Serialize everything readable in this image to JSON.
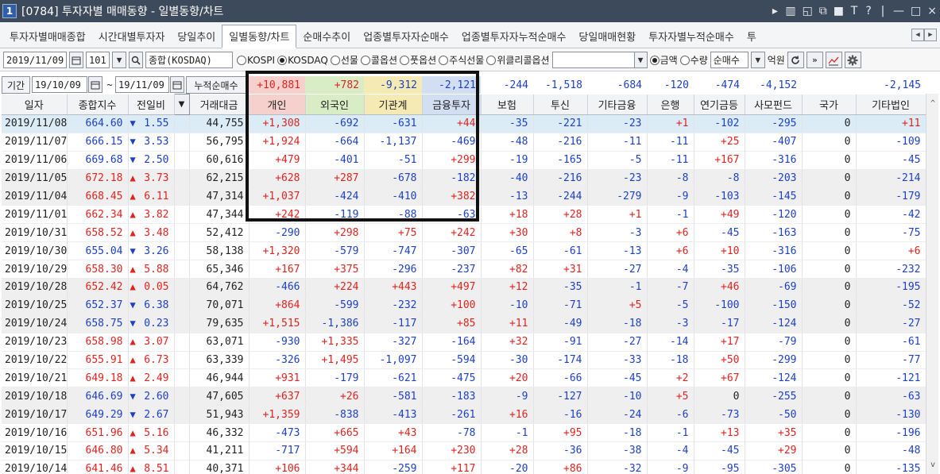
{
  "window": {
    "number": "1",
    "title": "[0784] 투자자별 매매동향 - 일별동향/차트",
    "controls": [
      "▸",
      "▥",
      "◱",
      "⧉",
      "■",
      "T",
      "?",
      "|",
      "—",
      "□",
      "×"
    ]
  },
  "tabs": [
    {
      "label": "투자자별매매종합",
      "active": false
    },
    {
      "label": "시간대별투자자",
      "active": false
    },
    {
      "label": "당일추이",
      "active": false
    },
    {
      "label": "일별동향/차트",
      "active": true
    },
    {
      "label": "순매수추이",
      "active": false
    },
    {
      "label": "업종별투자자순매수",
      "active": false
    },
    {
      "label": "업종별투자자누적순매수",
      "active": false
    },
    {
      "label": "당일매매현황",
      "active": false
    },
    {
      "label": "투자자별누적순매수",
      "active": false
    },
    {
      "label": "투",
      "active": false
    }
  ],
  "tab_nav": {
    "prev": "◀",
    "next": "▶"
  },
  "toolbar": {
    "date": "2019/11/09",
    "calendar_icon": "calendar-icon",
    "code": "101",
    "code_dropdown": "▼",
    "search_icon": "search-icon",
    "index_name": "종합(KOSDAQ)",
    "market_radios": [
      {
        "label": "KOSPI",
        "checked": false
      },
      {
        "label": "KOSDAQ",
        "checked": true
      },
      {
        "label": "선물",
        "checked": false
      },
      {
        "label": "콜옵션",
        "checked": false
      },
      {
        "label": "풋옵션",
        "checked": false
      },
      {
        "label": "주식선물",
        "checked": false
      },
      {
        "label": "위클리콜옵션",
        "checked": false
      }
    ],
    "amount_radios": [
      {
        "label": "금액",
        "checked": true
      },
      {
        "label": "수량",
        "checked": false
      }
    ],
    "sort_select": "순매수",
    "sort_dropdown": "▼",
    "unit": "억원",
    "refresh_icon": "refresh-icon",
    "next_icon": "double-chevron-right-icon",
    "chart_icon": "chart-icon",
    "settings_icon": "gear-icon"
  },
  "summary": {
    "period_label": "기간",
    "start_date": "19/10/09",
    "tilde": "~",
    "end_date": "19/11/09",
    "cumulative_label": "누적순매수",
    "totals": [
      "+10,881",
      "+782",
      "-9,312",
      "-2,121",
      "-244",
      "-1,518",
      "-684",
      "-120",
      "-474",
      "-4,152",
      "",
      "-2,145"
    ]
  },
  "headers": [
    "일자",
    "종합지수",
    "전일비",
    "▼",
    "거래대금",
    "개인",
    "외국인",
    "기관계",
    "금융투자",
    "보험",
    "투신",
    "기타금융",
    "은행",
    "연기금등",
    "사모펀드",
    "국가",
    "기타법인"
  ],
  "rows": [
    {
      "date": "2019/11/08",
      "index": "664.60",
      "dir": "down",
      "change": "1.55",
      "volume": "44,755",
      "vals": [
        "+1,308",
        "-692",
        "-631",
        "+44",
        "-35",
        "-221",
        "-23",
        "+1",
        "-102",
        "-295",
        "0",
        "+11"
      ]
    },
    {
      "date": "2019/11/07",
      "index": "666.15",
      "dir": "down",
      "change": "3.53",
      "volume": "56,795",
      "vals": [
        "+1,924",
        "-664",
        "-1,137",
        "-469",
        "-48",
        "-216",
        "-11",
        "-11",
        "+25",
        "-407",
        "0",
        "-109"
      ]
    },
    {
      "date": "2019/11/06",
      "index": "669.68",
      "dir": "down",
      "change": "2.50",
      "volume": "60,616",
      "vals": [
        "+479",
        "-401",
        "-51",
        "+299",
        "-19",
        "-165",
        "-5",
        "-11",
        "+167",
        "-316",
        "0",
        "-45"
      ]
    },
    {
      "date": "2019/11/05",
      "index": "672.18",
      "dir": "up",
      "change": "3.73",
      "volume": "62,215",
      "vals": [
        "+628",
        "+287",
        "-678",
        "-182",
        "-40",
        "-216",
        "-23",
        "-8",
        "-8",
        "-203",
        "0",
        "-214"
      ]
    },
    {
      "date": "2019/11/04",
      "index": "668.45",
      "dir": "up",
      "change": "6.11",
      "volume": "47,314",
      "vals": [
        "+1,037",
        "-424",
        "-410",
        "+382",
        "-13",
        "-244",
        "-279",
        "-9",
        "-103",
        "-145",
        "0",
        "-179"
      ]
    },
    {
      "date": "2019/11/01",
      "index": "662.34",
      "dir": "up",
      "change": "3.82",
      "volume": "47,344",
      "vals": [
        "+242",
        "-119",
        "-88",
        "-63",
        "+18",
        "+28",
        "+1",
        "-1",
        "+49",
        "-120",
        "0",
        "-42"
      ]
    },
    {
      "date": "2019/10/31",
      "index": "658.52",
      "dir": "up",
      "change": "3.48",
      "volume": "52,412",
      "vals": [
        "-290",
        "+298",
        "+75",
        "+242",
        "+30",
        "+8",
        "-3",
        "+6",
        "-45",
        "-163",
        "0",
        "-75"
      ]
    },
    {
      "date": "2019/10/30",
      "index": "655.04",
      "dir": "down",
      "change": "3.26",
      "volume": "58,138",
      "vals": [
        "+1,320",
        "-579",
        "-747",
        "-307",
        "-65",
        "-61",
        "-13",
        "+6",
        "+10",
        "-316",
        "0",
        "+6"
      ]
    },
    {
      "date": "2019/10/29",
      "index": "658.30",
      "dir": "up",
      "change": "5.88",
      "volume": "65,346",
      "vals": [
        "+167",
        "+375",
        "-296",
        "-237",
        "+82",
        "+31",
        "-27",
        "-4",
        "-35",
        "-106",
        "0",
        "-232"
      ]
    },
    {
      "date": "2019/10/28",
      "index": "652.42",
      "dir": "up",
      "change": "0.05",
      "volume": "64,762",
      "vals": [
        "-466",
        "+224",
        "+443",
        "+497",
        "+12",
        "-35",
        "-1",
        "-7",
        "+46",
        "-69",
        "0",
        "-195"
      ]
    },
    {
      "date": "2019/10/25",
      "index": "652.37",
      "dir": "down",
      "change": "6.38",
      "volume": "70,071",
      "vals": [
        "+864",
        "-599",
        "-232",
        "+100",
        "-10",
        "-71",
        "+5",
        "-5",
        "-100",
        "-150",
        "0",
        "-52"
      ]
    },
    {
      "date": "2019/10/24",
      "index": "658.75",
      "dir": "down",
      "change": "0.23",
      "volume": "79,635",
      "vals": [
        "+1,515",
        "-1,386",
        "-117",
        "+85",
        "+11",
        "-49",
        "-18",
        "-3",
        "-17",
        "-124",
        "0",
        "-27"
      ]
    },
    {
      "date": "2019/10/23",
      "index": "658.98",
      "dir": "up",
      "change": "3.07",
      "volume": "63,071",
      "vals": [
        "-930",
        "+1,335",
        "-327",
        "-164",
        "+32",
        "-91",
        "-27",
        "-14",
        "+17",
        "-79",
        "0",
        "-61"
      ]
    },
    {
      "date": "2019/10/22",
      "index": "655.91",
      "dir": "up",
      "change": "6.73",
      "volume": "63,339",
      "vals": [
        "-326",
        "+1,495",
        "-1,097",
        "-594",
        "-30",
        "-174",
        "-33",
        "-18",
        "+50",
        "-299",
        "0",
        "-77"
      ]
    },
    {
      "date": "2019/10/21",
      "index": "649.18",
      "dir": "up",
      "change": "2.49",
      "volume": "46,944",
      "vals": [
        "+931",
        "-179",
        "-621",
        "-475",
        "+20",
        "-66",
        "-45",
        "+2",
        "+67",
        "-124",
        "0",
        "-121"
      ]
    },
    {
      "date": "2019/10/18",
      "index": "646.69",
      "dir": "down",
      "change": "2.60",
      "volume": "47,605",
      "vals": [
        "+637",
        "+26",
        "-581",
        "-183",
        "-9",
        "-127",
        "-10",
        "+5",
        "0",
        "-255",
        "0",
        "-63"
      ]
    },
    {
      "date": "2019/10/17",
      "index": "649.29",
      "dir": "down",
      "change": "2.67",
      "volume": "51,943",
      "vals": [
        "+1,359",
        "-838",
        "-413",
        "-261",
        "+16",
        "-16",
        "-24",
        "-6",
        "-73",
        "-50",
        "0",
        "-130"
      ]
    },
    {
      "date": "2019/10/16",
      "index": "651.96",
      "dir": "up",
      "change": "5.16",
      "volume": "46,332",
      "vals": [
        "-473",
        "+665",
        "+43",
        "-78",
        "-1",
        "+95",
        "-18",
        "-1",
        "+13",
        "+35",
        "0",
        "-196"
      ]
    },
    {
      "date": "2019/10/15",
      "index": "646.80",
      "dir": "up",
      "change": "5.34",
      "volume": "41,211",
      "vals": [
        "-717",
        "+594",
        "+164",
        "+230",
        "+28",
        "-36",
        "-38",
        "-4",
        "-45",
        "+29",
        "0",
        "-48"
      ]
    },
    {
      "date": "2019/10/14",
      "index": "641.46",
      "dir": "up",
      "change": "8.51",
      "volume": "40,371",
      "vals": [
        "+106",
        "+344",
        "-259",
        "+117",
        "-20",
        "+86",
        "-32",
        "-9",
        "-95",
        "-305",
        "0",
        "-135"
      ]
    }
  ],
  "colors": {
    "up": "#e0231f",
    "down": "#1d40c6",
    "selected_row": "#dbecf7",
    "alt_row": "#efefef",
    "header_bg": "#f2f3f5",
    "individual_header": "#f6d0cd",
    "foreign_header": "#d8ecc6",
    "institution_header": "#f6eab4",
    "financial_header": "#d2def2",
    "title_bar": "#3d4a5c"
  },
  "scrollbar": {
    "up": "^",
    "down": "v"
  }
}
